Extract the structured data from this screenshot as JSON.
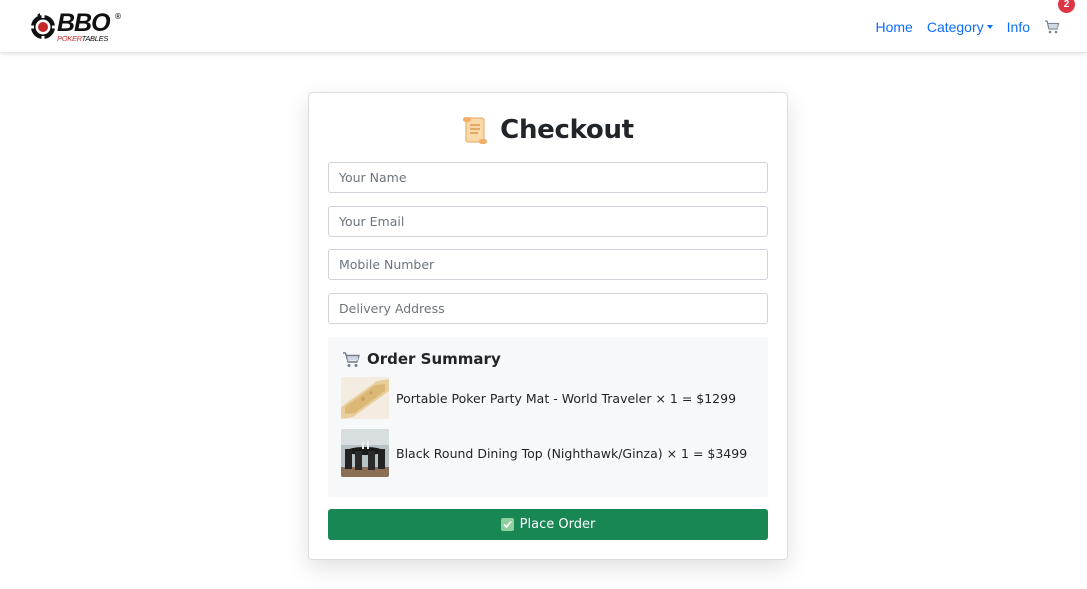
{
  "brand": {
    "name": "BBO",
    "registered": "®",
    "tagline_red": "POKER",
    "tagline_dark": "TABLES"
  },
  "nav": {
    "items": [
      {
        "label": "Home"
      },
      {
        "label": "Category"
      },
      {
        "label": "Info"
      }
    ],
    "cart_count": "2"
  },
  "checkout": {
    "title": "Checkout",
    "fields": {
      "name": {
        "value": "",
        "placeholder": "Your Name"
      },
      "email": {
        "value": "",
        "placeholder": "Your Email"
      },
      "mobile": {
        "value": "",
        "placeholder": "Mobile Number"
      },
      "address": {
        "value": "",
        "placeholder": "Delivery Address"
      }
    },
    "summary": {
      "title": "Order Summary",
      "items": [
        {
          "text": "Portable Poker Party Mat - World Traveler × 1 = $1299"
        },
        {
          "text": "Black Round Dining Top (Nighthawk/Ginza) × 1 = $3499"
        }
      ]
    },
    "place_order_label": "Place Order"
  },
  "colors": {
    "link": "#0d6efd",
    "badge": "#dc3545",
    "primary_action": "#198754",
    "summary_bg": "#f7f8fa"
  },
  "icons": {
    "title": "scroll-icon",
    "summary": "shopping-cart-icon",
    "nav_cart": "shopping-cart-icon",
    "button": "check-mark-icon"
  }
}
